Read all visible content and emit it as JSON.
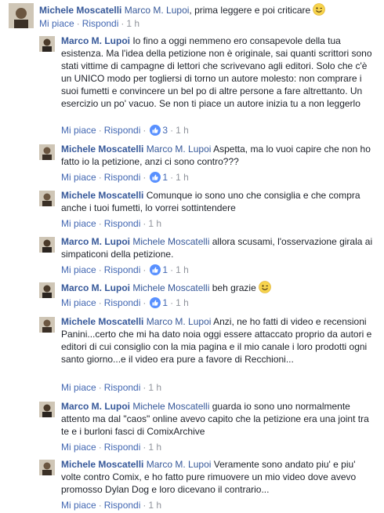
{
  "colors": {
    "link": "#4267b2",
    "name": "#365899",
    "meta": "#90949c",
    "like_badge": "#5890ff"
  },
  "actions": {
    "like": "Mi piace",
    "reply": "Rispondi",
    "sep": "·"
  },
  "comments": [
    {
      "author": "Michele Moscatelli",
      "mention": "Marco M. Lupoi",
      "text": ", prima leggere e poi criticare",
      "emoji": "wink-emoji",
      "time": "1 h"
    },
    {
      "author": "Marco M. Lupoi",
      "mention": "",
      "text": "Io fino a oggi nemmeno ero consapevole della tua esistenza. Ma l'idea della petizione non è originale, sai quanti scrittori sono stati vittime di campagne di lettori che scrivevano agli editori. Solo che c'è un UNICO modo per togliersi di torno un autore molesto: non comprare i suoi fumetti e convincere un bel po di altre persone a fare altrettanto. Un esercizio un po' vacuo. Se non ti piace un autore inizia tu a non leggerlo",
      "likes": "3",
      "time": "1 h"
    },
    {
      "author": "Michele Moscatelli",
      "mention": "Marco M. Lupoi",
      "text": "Aspetta, ma lo vuoi capire che non ho fatto io la petizione, anzi ci sono contro???",
      "likes": "1",
      "time": "1 h"
    },
    {
      "author": "Michele Moscatelli",
      "mention": "",
      "text": "Comunque io sono uno che consiglia e che compra anche i tuoi fumetti, lo vorrei sottintendere",
      "time": "1 h"
    },
    {
      "author": "Marco M. Lupoi",
      "mention": "Michele Moscatelli",
      "text": "allora scusami, l'osservazione girala ai simpaticoni della petizione.",
      "likes": "1",
      "time": "1 h"
    },
    {
      "author": "Marco M. Lupoi",
      "mention": "Michele Moscatelli",
      "text": "beh grazie",
      "emoji": "wink-emoji",
      "likes": "1",
      "time": "1 h"
    },
    {
      "author": "Michele Moscatelli",
      "mention": "Marco M. Lupoi",
      "text": "Anzi, ne ho fatti di video e recensioni Panini...certo che mi ha dato noia oggi essere attaccato proprio da autori e editori di cui consiglio con la mia pagina e il mio canale i loro prodotti ogni santo giorno...e il video era pure a favore di Recchioni...",
      "time": "1 h"
    },
    {
      "author": "Marco M. Lupoi",
      "mention": "Michele Moscatelli",
      "text": "guarda io sono uno normalmente attento ma dal \"caos\" online avevo capito che la petizione era una joint tra te e i burloni fasci di ComixArchive",
      "time": "1 h"
    },
    {
      "author": "Michele Moscatelli",
      "mention": "Marco M. Lupoi",
      "text": "Veramente sono andato piu' e piu' volte contro Comix, e ho fatto pure rimuovere un mio video dove avevo promosso Dylan Dog e loro dicevano il contrario...",
      "time": "1 h"
    }
  ]
}
